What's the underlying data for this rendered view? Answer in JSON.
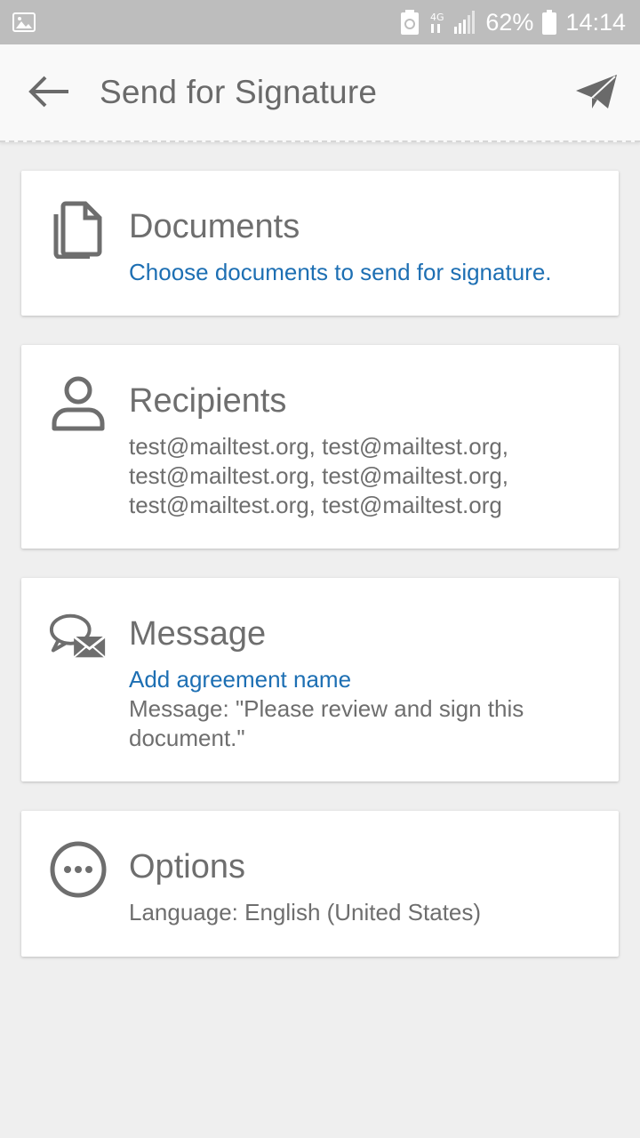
{
  "status_bar": {
    "battery": "62%",
    "time": "14:14",
    "network": "4G",
    "icons": [
      "image-icon",
      "recycle-icon",
      "data-4g-icon",
      "signal-icon",
      "battery-icon"
    ]
  },
  "app_bar": {
    "title": "Send for Signature",
    "back_icon": "arrow-left-icon",
    "send_icon": "paper-plane-icon"
  },
  "sections": {
    "documents": {
      "heading": "Documents",
      "subtitle": "Choose documents to send for signature.",
      "icon": "documents-icon"
    },
    "recipients": {
      "heading": "Recipients",
      "lines": [
        "test@mailtest.org, test@mailtest.org,",
        "test@mailtest.org, test@mailtest.org,",
        "test@mailtest.org, test@mailtest.org"
      ],
      "icon": "person-icon"
    },
    "message": {
      "heading": "Message",
      "agreement_link": "Add agreement name",
      "message_lines": [
        "Message: \"Please review and sign this",
        "document.\""
      ],
      "icon": "chat-mail-icon"
    },
    "options": {
      "heading": "Options",
      "language": "Language: English (United States)",
      "icon": "more-icon"
    }
  },
  "colors": {
    "link": "#1d6fb3",
    "text": "#6e6e6e",
    "status_bar": "#bdbdbd",
    "background": "#efefef"
  }
}
